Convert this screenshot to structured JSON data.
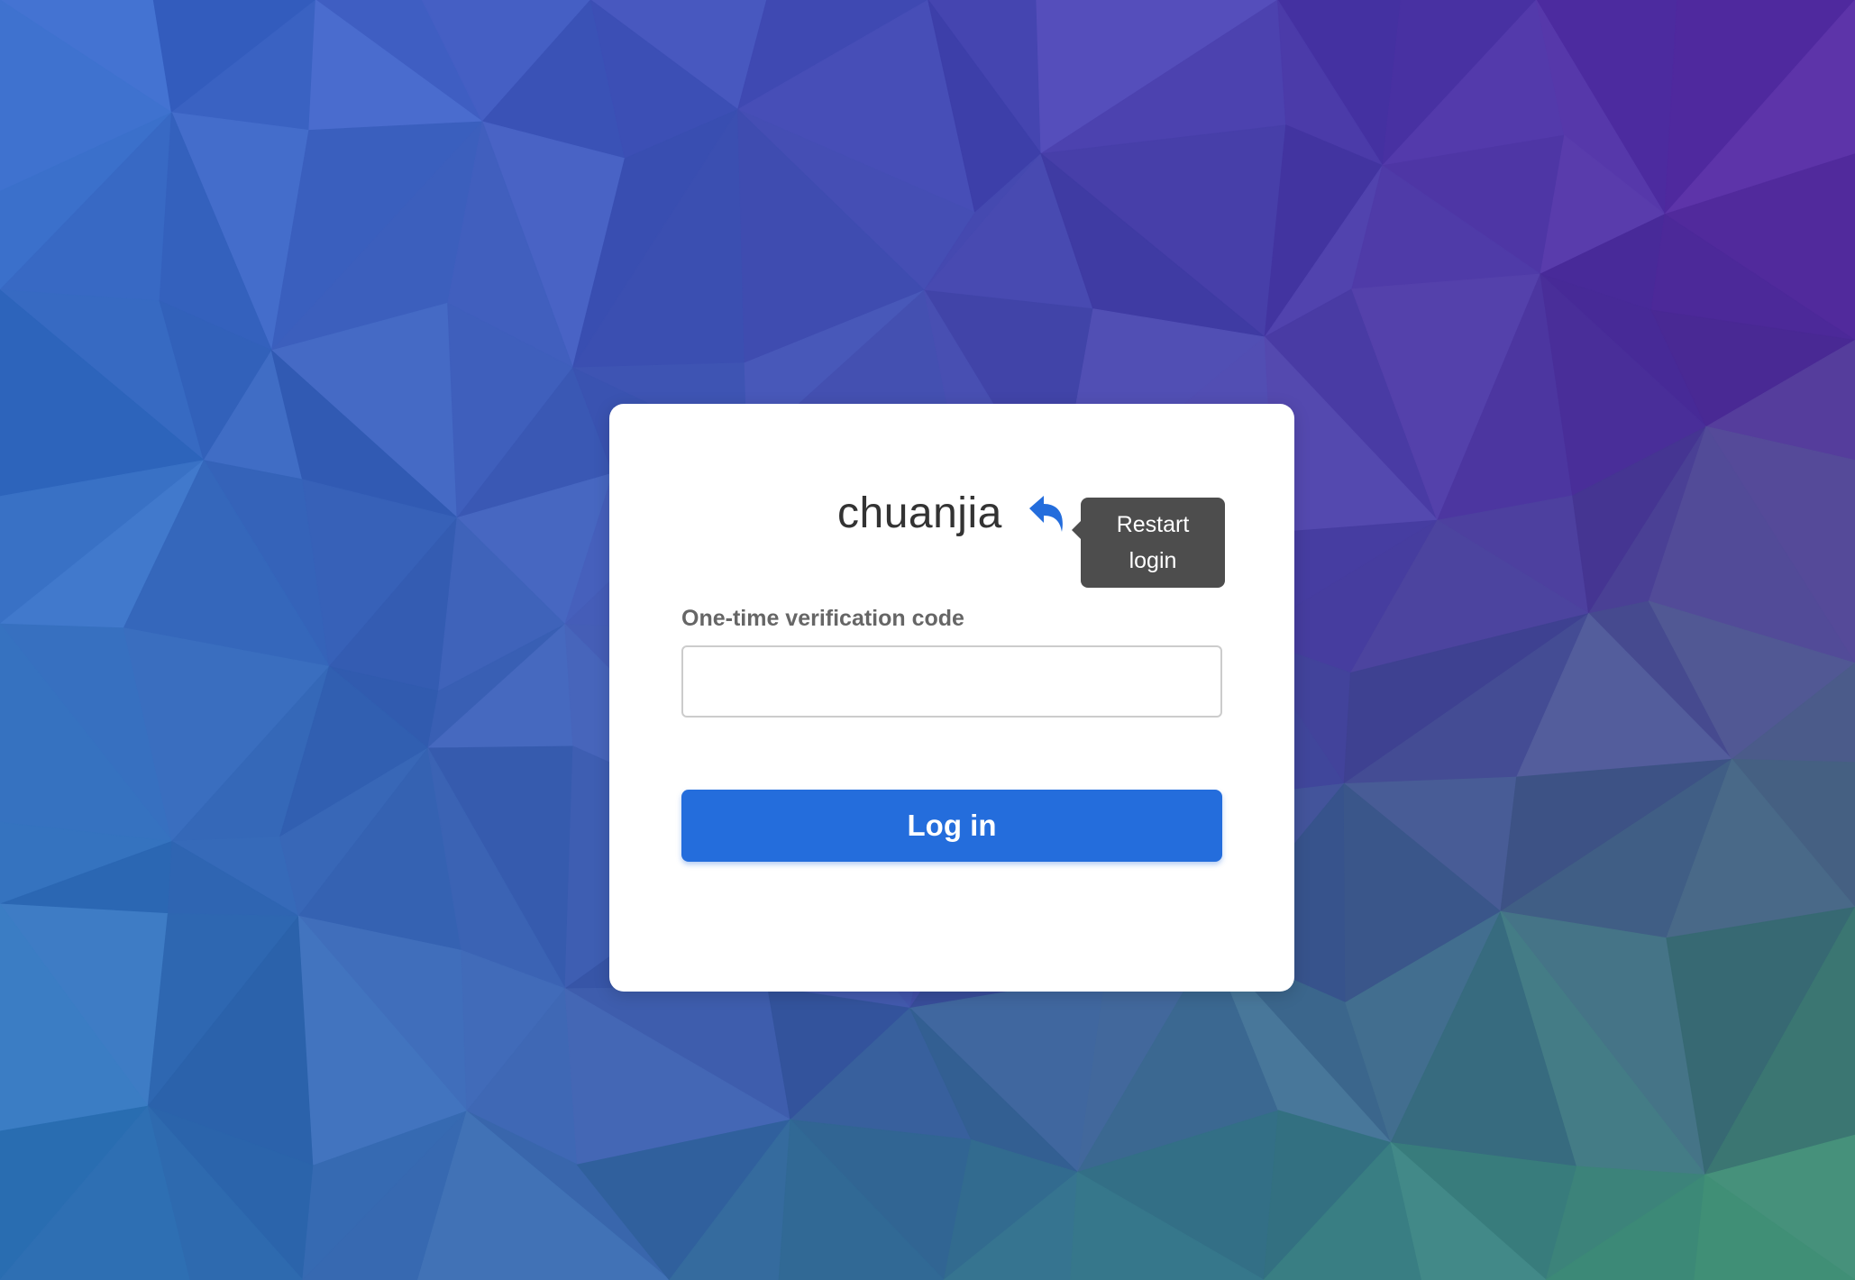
{
  "login": {
    "username": "chuanjia",
    "restart_tooltip": "Restart login",
    "code_label": "One-time verification code",
    "code_value": "",
    "code_placeholder": "",
    "login_button_label": "Log in"
  },
  "icons": {
    "restart": "undo-arrow-icon"
  },
  "colors": {
    "accent": "#246ddc",
    "tooltip_bg": "#4d4d4d",
    "card_bg": "#ffffff",
    "title_text": "#333333",
    "label_text": "#666666"
  }
}
